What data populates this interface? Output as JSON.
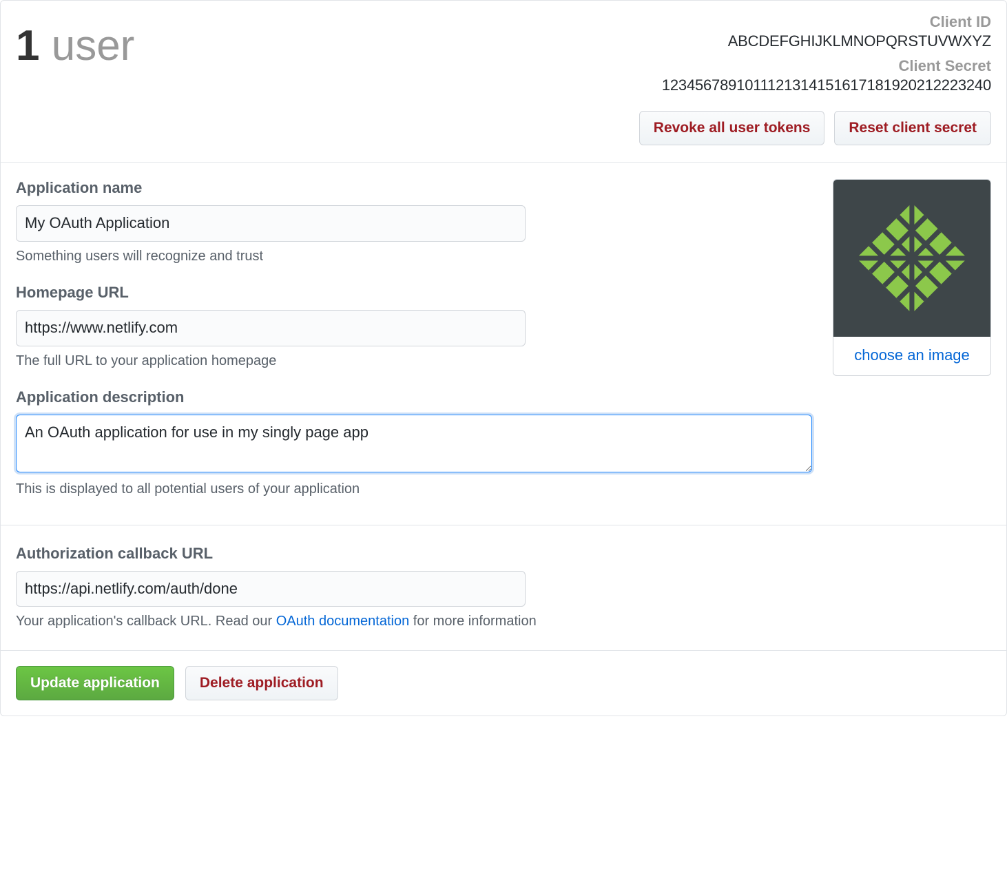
{
  "header": {
    "user_count_number": "1",
    "user_count_word": "user",
    "client_id_label": "Client ID",
    "client_id_value": "ABCDEFGHIJKLMNOPQRSTUVWXYZ",
    "client_secret_label": "Client Secret",
    "client_secret_value": "1234567891011121314151617181920212223240",
    "revoke_button": "Revoke all user tokens",
    "reset_button": "Reset client secret"
  },
  "form": {
    "app_name_label": "Application name",
    "app_name_value": "My OAuth Application",
    "app_name_help": "Something users will recognize and trust",
    "homepage_label": "Homepage URL",
    "homepage_value": "https://www.netlify.com",
    "homepage_help": "The full URL to your application homepage",
    "description_label": "Application description",
    "description_value": "An OAuth application for use in my singly page app",
    "description_help": "This is displayed to all potential users of your application",
    "callback_label": "Authorization callback URL",
    "callback_value": "https://api.netlify.com/auth/done",
    "callback_help_pre": "Your application's callback URL. Read our ",
    "callback_help_link": "OAuth documentation",
    "callback_help_post": " for more information"
  },
  "logo": {
    "choose_label": "choose an image",
    "icon_name": "netlify-logo",
    "bg_color": "#3e4649",
    "accent_color": "#8cc84b"
  },
  "actions": {
    "update": "Update application",
    "delete": "Delete application"
  }
}
